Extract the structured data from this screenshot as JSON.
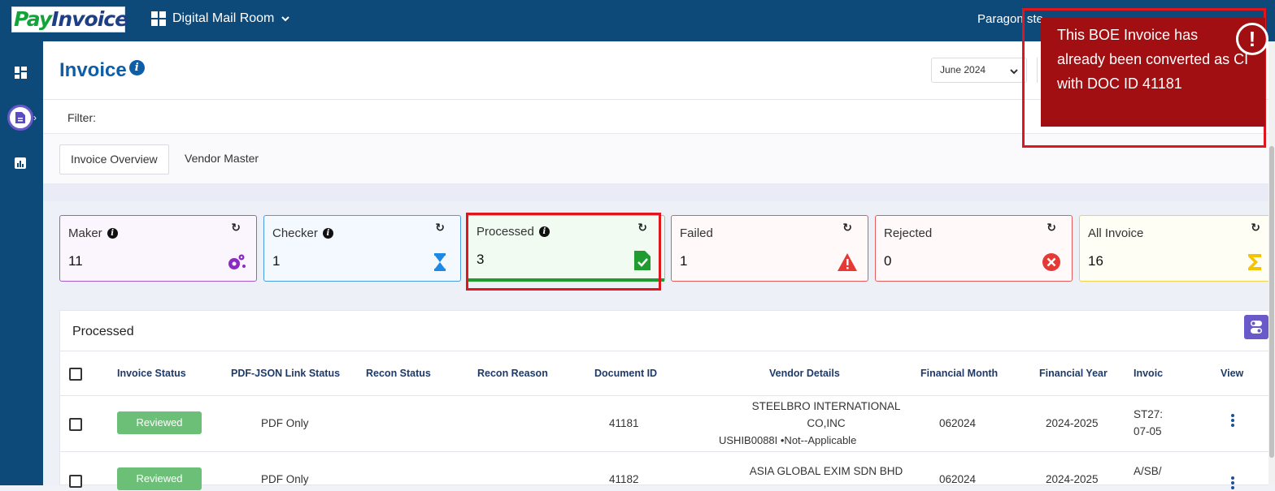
{
  "app": {
    "logo_pay": "Pay",
    "logo_invoice": "Invoice",
    "module_label": "Digital Mail Room",
    "user_label": "Paragon ste"
  },
  "page": {
    "title": "Invoice",
    "month_value": "June 2024",
    "filter_label": "Filter:",
    "tabs": [
      "Invoice Overview",
      "Vendor Master"
    ]
  },
  "cards": [
    {
      "label": "Maker",
      "count": "11",
      "icon": "gears-icon",
      "color": "#8a2cc2"
    },
    {
      "label": "Checker",
      "count": "1",
      "icon": "hourglass-icon",
      "color": "#1e88e5"
    },
    {
      "label": "Processed",
      "count": "3",
      "icon": "file-check-icon",
      "color": "#1f9b2f"
    },
    {
      "label": "Failed",
      "count": "1",
      "icon": "warning-icon",
      "color": "#e53935"
    },
    {
      "label": "Rejected",
      "count": "0",
      "icon": "cancel-icon",
      "color": "#e53935"
    },
    {
      "label": "All Invoice",
      "count": "16",
      "icon": "sigma-icon",
      "color": "#f5c400"
    }
  ],
  "panel": {
    "title": "Processed",
    "columns": [
      "Invoice Status",
      "PDF-JSON Link Status",
      "Recon Status",
      "Recon Reason",
      "Document ID",
      "Vendor Details",
      "Financial Month",
      "Financial Year",
      "Invoic",
      "View"
    ],
    "rows": [
      {
        "status": "Reviewed",
        "link_status": "PDF Only",
        "doc_id": "41181",
        "vendor_line1": "STEELBRO INTERNATIONAL",
        "vendor_line2": "CO,INC",
        "vendor_line3": "USHIB0088I  •Not--Applicable",
        "fin_month": "062024",
        "fin_year": "2024-2025",
        "invoice_1": "ST27:",
        "invoice_2": "07-05"
      },
      {
        "status": "Reviewed",
        "link_status": "PDF Only",
        "doc_id": "41182",
        "vendor_line1": "ASIA GLOBAL EXIM SDN BHD",
        "fin_month": "062024",
        "fin_year": "2024-2025",
        "invoice_1": "A/SB/"
      }
    ]
  },
  "toast": {
    "message": "This BOE Invoice has already been converted as CI with DOC ID 41181",
    "icon": "alert-circle-icon",
    "color": "#a10f12"
  }
}
